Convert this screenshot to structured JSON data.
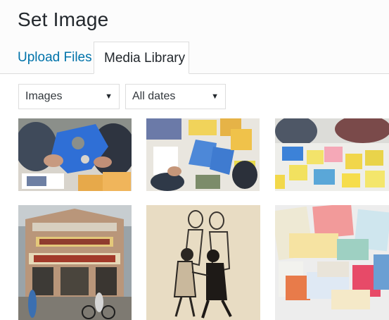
{
  "modal": {
    "title": "Set Image"
  },
  "tabs": [
    {
      "label": "Upload Files",
      "active": false
    },
    {
      "label": "Media Library",
      "active": true
    }
  ],
  "filters": {
    "type": {
      "selected": "Images"
    },
    "date": {
      "selected": "All dates"
    }
  },
  "media_items": [
    {
      "icon": "photo-workshop-blue-cutout"
    },
    {
      "icon": "photo-workshop-paper-crafts"
    },
    {
      "icon": "photo-workshop-sticky-notes"
    },
    {
      "icon": "photo-restaurant-bakery-storefront"
    },
    {
      "icon": "photo-dancing-couple-illustration"
    },
    {
      "icon": "photo-concert-ticket-collage"
    }
  ],
  "colors": {
    "link": "#0073aa",
    "border": "#dddddd",
    "header_bg": "#fcfcfc"
  }
}
